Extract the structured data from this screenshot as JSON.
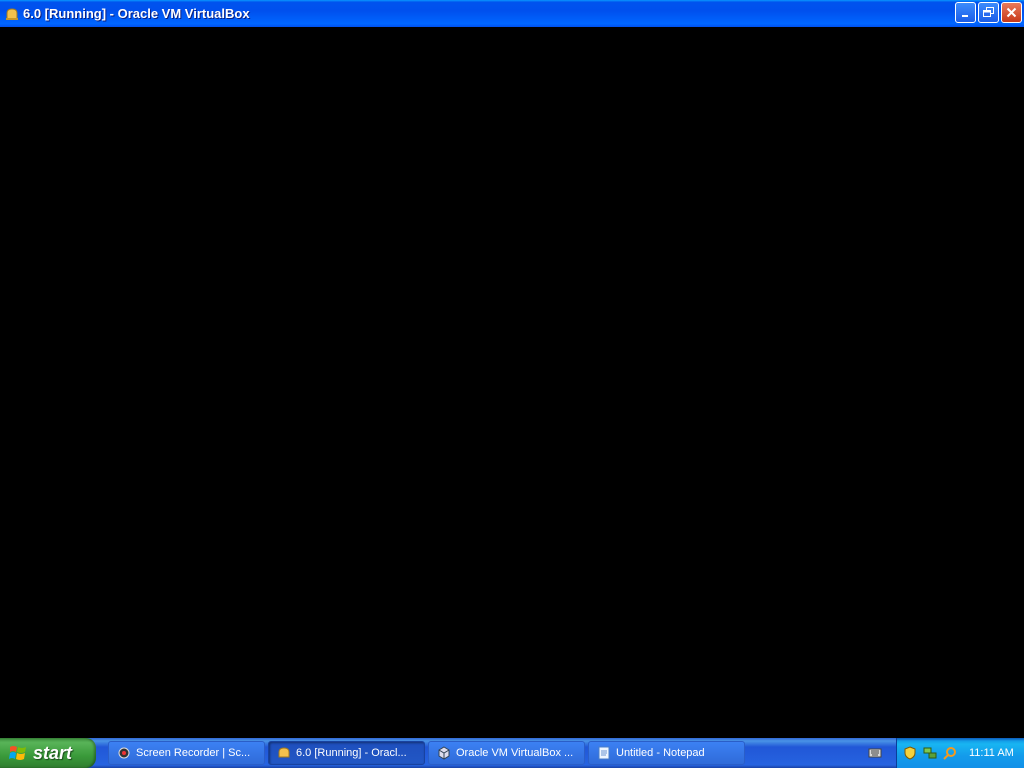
{
  "window": {
    "title": "6.0 [Running] - Oracle VM VirtualBox"
  },
  "taskbar": {
    "start_label": "start",
    "tasks": [
      {
        "label": "Screen Recorder | Sc...",
        "icon": "screen-recorder-icon",
        "active": false
      },
      {
        "label": "6.0 [Running] - Oracl...",
        "icon": "virtualbox-vm-icon",
        "active": true
      },
      {
        "label": "Oracle VM VirtualBox ...",
        "icon": "virtualbox-icon",
        "active": false
      },
      {
        "label": "Untitled - Notepad",
        "icon": "notepad-icon",
        "active": false
      }
    ],
    "clock": "11:11 AM"
  },
  "colors": {
    "titlebar": "#0054e3",
    "taskbar": "#245edb",
    "start": "#3c9a3c",
    "screen": "#000000"
  }
}
